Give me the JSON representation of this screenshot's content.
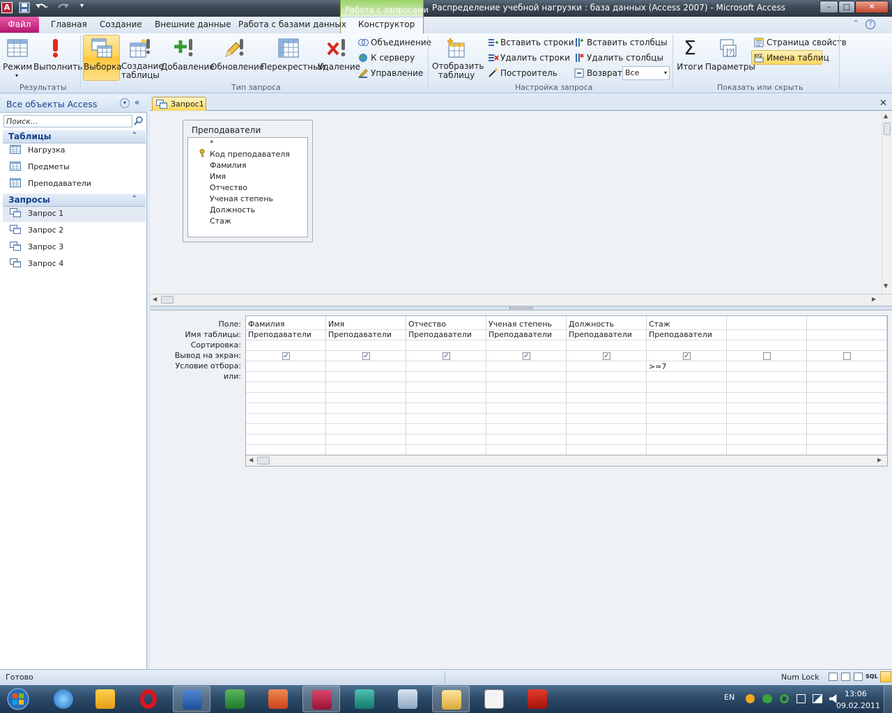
{
  "window": {
    "title": "Распределение учебной нагрузки : база данных (Access 2007)  -  Microsoft Access",
    "app_letter": "A",
    "controls": {
      "minimize": "–",
      "maximize": "□",
      "close": "✕"
    }
  },
  "ribbon": {
    "context_header": "Работа с запросами",
    "file_tab": "Файл",
    "tabs": [
      "Главная",
      "Создание",
      "Внешние данные",
      "Работа с базами данных",
      "Конструктор"
    ],
    "groups": {
      "results": {
        "label": "Результаты",
        "mode": "Режим",
        "run": "Выполнить"
      },
      "query_type": {
        "label": "Тип запроса",
        "select": "Выборка",
        "make_table_1": "Создание",
        "make_table_2": "таблицы",
        "append": "Добавление",
        "update": "Обновление",
        "crosstab": "Перекрестный",
        "delete": "Удаление",
        "union": "Объединение",
        "pass_through": "К серверу",
        "data_definition": "Управление"
      },
      "query_setup": {
        "label": "Настройка запроса",
        "show_table_1": "Отобразить",
        "show_table_2": "таблицу",
        "insert_rows": "Вставить строки",
        "delete_rows": "Удалить строки",
        "builder": "Построитель",
        "insert_cols": "Вставить столбцы",
        "delete_cols": "Удалить столбцы",
        "return_label": "Возврат:",
        "return_value": "Все"
      },
      "show_hide": {
        "label": "Показать или скрыть",
        "totals": "Итоги",
        "params": "Параметры",
        "property_sheet": "Страница свойств",
        "table_names": "Имена таблиц"
      }
    }
  },
  "nav": {
    "title": "Все объекты Access",
    "search_placeholder": "Поиск...",
    "sections": [
      {
        "title": "Таблицы",
        "items": [
          "Нагрузка",
          "Предметы",
          "Преподаватели"
        ]
      },
      {
        "title": "Запросы",
        "items": [
          "Запрос 1",
          "Запрос 2",
          "Запрос 3",
          "Запрос 4"
        ]
      }
    ]
  },
  "document": {
    "tab": "Запрос1",
    "table_box": {
      "title": "Преподаватели",
      "fields": [
        "*",
        "Код преподавателя",
        "Фамилия",
        "Имя",
        "Отчество",
        "Ученая степень",
        "Должность",
        "Стаж"
      ]
    },
    "grid": {
      "row_labels": [
        "Поле:",
        "Имя таблицы:",
        "Сортировка:",
        "Вывод на экран:",
        "Условие отбора:",
        "или:"
      ],
      "columns": [
        {
          "field": "Фамилия",
          "table": "Преподаватели",
          "show": true,
          "criteria": ""
        },
        {
          "field": "Имя",
          "table": "Преподаватели",
          "show": true,
          "criteria": ""
        },
        {
          "field": "Отчество",
          "table": "Преподаватели",
          "show": true,
          "criteria": ""
        },
        {
          "field": "Ученая степень",
          "table": "Преподаватели",
          "show": true,
          "criteria": ""
        },
        {
          "field": "Должность",
          "table": "Преподаватели",
          "show": true,
          "criteria": ""
        },
        {
          "field": "Стаж",
          "table": "Преподаватели",
          "show": true,
          "criteria": ">=7"
        },
        {
          "field": "",
          "table": "",
          "show": false,
          "criteria": ""
        },
        {
          "field": "",
          "table": "",
          "show": false,
          "criteria": ""
        }
      ]
    }
  },
  "statusbar": {
    "left": "Готово",
    "numlock": "Num Lock",
    "sql": "SQL"
  },
  "taskbar": {
    "lang": "EN",
    "time": "13:06",
    "date": "09.02.2011",
    "apps": [
      "internet-explorer",
      "outlook",
      "opera",
      "word",
      "excel",
      "powerpoint",
      "access",
      "publisher",
      "calculator",
      "explorer",
      "notepad",
      "acrobat"
    ]
  },
  "colors": {
    "accent": "#2b579a",
    "file_tab": "#c4207a",
    "selected": "#ffd35a",
    "context": "#9bd36a"
  }
}
